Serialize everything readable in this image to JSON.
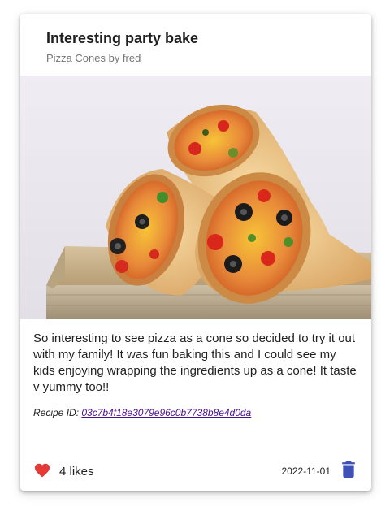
{
  "card": {
    "title": "Interesting party bake",
    "subtitle": "Pizza Cones by fred",
    "description": "So interesting to see pizza as a cone so decided to try it out with my family! It was fun baking this and I could see my kids enjoying wrapping the ingredients up as a cone! It taste v yummy too!!",
    "recipe_label": "Recipe ID: ",
    "recipe_id": "03c7b4f18e3079e96c0b7738b8e4d0da",
    "likes": "4 likes",
    "date": "2022-11-01",
    "image_alt": "pizza-cones-photo"
  },
  "icons": {
    "like": "heart-icon",
    "delete": "trash-icon"
  },
  "colors": {
    "heart": "#e53935",
    "trash": "#3f51b5",
    "link": "#4a0f8c"
  }
}
